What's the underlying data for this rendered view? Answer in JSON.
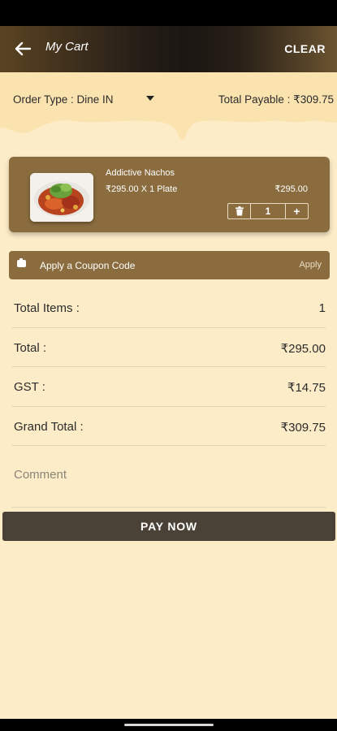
{
  "header": {
    "title": "My Cart",
    "back_icon": "arrow-left-icon",
    "clear_label": "CLEAR"
  },
  "order": {
    "type_label": "Order Type : Dine IN",
    "total_payable": "Total Payable : ₹309.75"
  },
  "cart_items": [
    {
      "name": "Addictive Nachos",
      "qty_line": "₹295.00 X 1 Plate",
      "price": "₹295.00",
      "quantity": "1",
      "plus_label": "+"
    }
  ],
  "coupon": {
    "label": "Apply a Coupon Code",
    "apply_label": "Apply"
  },
  "summary": [
    {
      "label": "Total Items :",
      "value": "1"
    },
    {
      "label": "Total :",
      "value": "₹295.00"
    },
    {
      "label": "GST :",
      "value": "₹14.75"
    },
    {
      "label": "Grand Total :",
      "value": "₹309.75"
    }
  ],
  "comment": {
    "placeholder": "Comment"
  },
  "pay_button": {
    "label": "PAY NOW"
  },
  "colors": {
    "background": "#fdecc8",
    "card": "#8a6c3e",
    "pay_button": "#4a4236"
  }
}
